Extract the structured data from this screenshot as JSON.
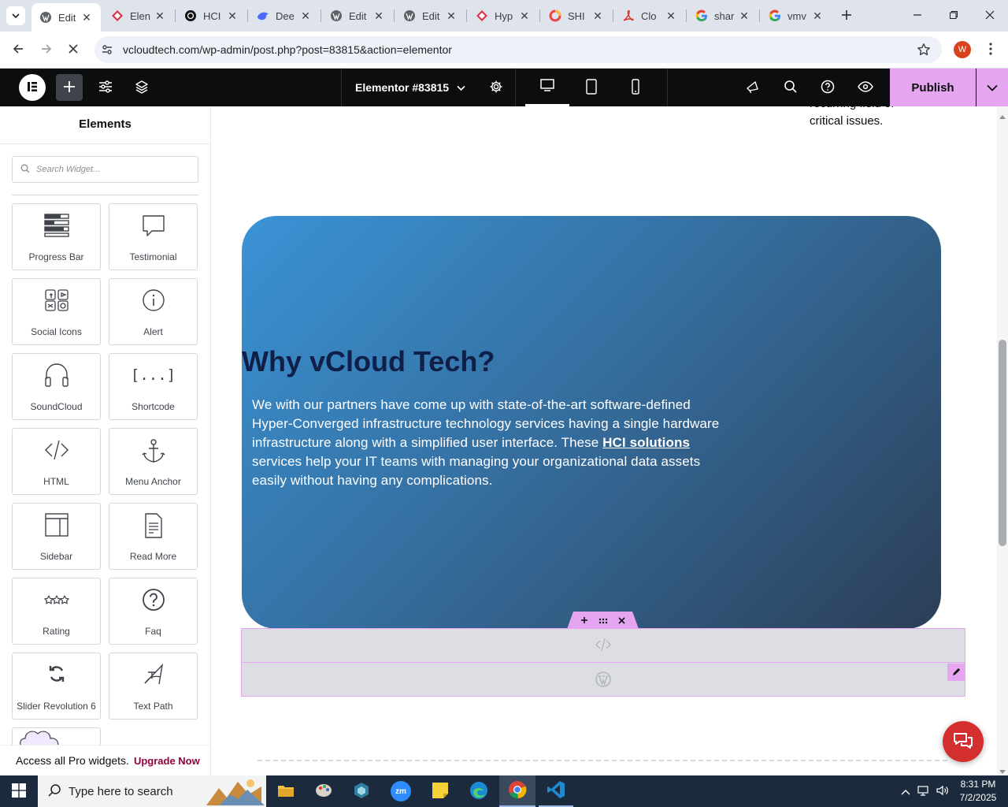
{
  "browser": {
    "tabs": [
      {
        "title": "Edit",
        "icon": "wordpress-icon",
        "active": true
      },
      {
        "title": "Elen",
        "icon": "elementor-icon"
      },
      {
        "title": "HCI",
        "icon": "chatgpt-icon"
      },
      {
        "title": "Dee",
        "icon": "deepseek-icon"
      },
      {
        "title": "Edit",
        "icon": "wordpress-icon"
      },
      {
        "title": "Edit",
        "icon": "wordpress-icon"
      },
      {
        "title": "Hyp",
        "icon": "elementor-icon"
      },
      {
        "title": "SHI",
        "icon": "ring-icon"
      },
      {
        "title": "Clo",
        "icon": "acrobat-icon"
      },
      {
        "title": "shar",
        "icon": "google-icon"
      },
      {
        "title": "vmv",
        "icon": "google-icon"
      }
    ],
    "url": "vcloudtech.com/wp-admin/post.php?post=83815&action=elementor",
    "profile_initial": "W"
  },
  "editor": {
    "document_title": "Elementor #83815",
    "publish_label": "Publish"
  },
  "panel": {
    "title": "Elements",
    "search_placeholder": "Search Widget...",
    "widgets": [
      {
        "label": "Progress Bar",
        "icon": "progress-bar-icon"
      },
      {
        "label": "Testimonial",
        "icon": "speech-bubble-icon"
      },
      {
        "label": "Social Icons",
        "icon": "social-icons-icon"
      },
      {
        "label": "Alert",
        "icon": "info-icon"
      },
      {
        "label": "SoundCloud",
        "icon": "headphones-icon"
      },
      {
        "label": "Shortcode",
        "icon": "shortcode-icon"
      },
      {
        "label": "HTML",
        "icon": "code-icon"
      },
      {
        "label": "Menu Anchor",
        "icon": "anchor-icon"
      },
      {
        "label": "Sidebar",
        "icon": "sidebar-icon"
      },
      {
        "label": "Read More",
        "icon": "document-icon"
      },
      {
        "label": "Rating",
        "icon": "stars-icon"
      },
      {
        "label": "Faq",
        "icon": "question-icon"
      },
      {
        "label": "Slider Revolution 6",
        "icon": "refresh-icon"
      },
      {
        "label": "Text Path",
        "icon": "text-path-icon"
      }
    ],
    "pro_text": "Access all Pro widgets.",
    "upgrade_label": "Upgrade Now"
  },
  "canvas": {
    "partial_text_line1": "recurring field of",
    "partial_text_line2": "critical issues.",
    "hero_heading": "Why vCloud Tech?",
    "hero_body_before": "We with our partners have come up with state-of-the-art software-defined Hyper-Converged infrastructure technology services having a single hardware infrastructure along with a simplified user interface. These ",
    "hero_link": "HCI solutions",
    "hero_body_after": " services help your IT teams with managing your organizational data assets easily without having any complications."
  },
  "colors": {
    "accent_pink": "#e5a5f0",
    "heading_navy": "#0f1f48",
    "chat_red": "#d32f2f"
  },
  "taskbar": {
    "search_placeholder": "Type here to search",
    "time": "8:31 PM",
    "date": "7/2/2025"
  }
}
